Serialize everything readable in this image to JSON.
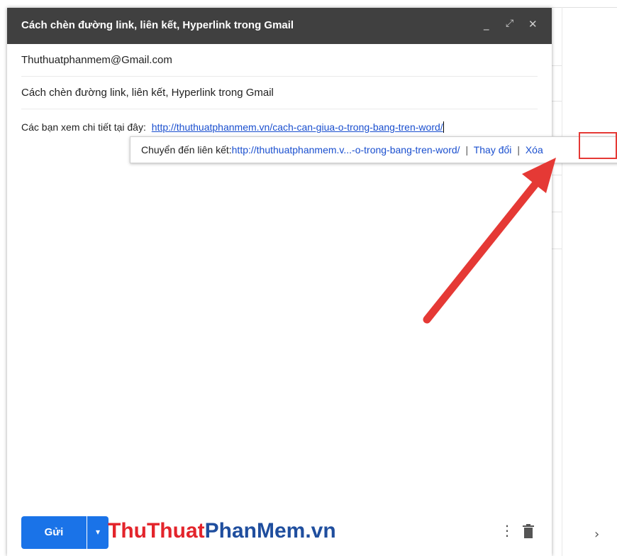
{
  "compose": {
    "title": "Cách chèn đường link, liên kết, Hyperlink trong Gmail",
    "minimize_icon": "minimize-icon",
    "expand_icon": "expand-icon",
    "close_icon": "close-icon",
    "to": "Thuthuatphanmem@Gmail.com",
    "subject": "Cách chèn đường link, liên kết, Hyperlink trong Gmail",
    "body_text": "Các bạn xem chi tiết tại đây:",
    "body_link": "http://thuthuatphanmem.vn/cach-can-giua-o-trong-bang-tren-word/"
  },
  "link_tooltip": {
    "label": "Chuyển đến liên kết:",
    "link": "http://thuthuatphanmem.v...-o-trong-bang-tren-word/",
    "separator": "|",
    "change": "Thay đổi",
    "remove": "Xóa"
  },
  "footer": {
    "send": "Gửi",
    "watermark_part1": "ThuThuat",
    "watermark_part2": "PhanMem.vn"
  },
  "colors": {
    "header_bg": "#404040",
    "link": "#1a4fcf",
    "send_button": "#1a73e8",
    "highlight": "#e53935",
    "arrow": "#e53935"
  }
}
